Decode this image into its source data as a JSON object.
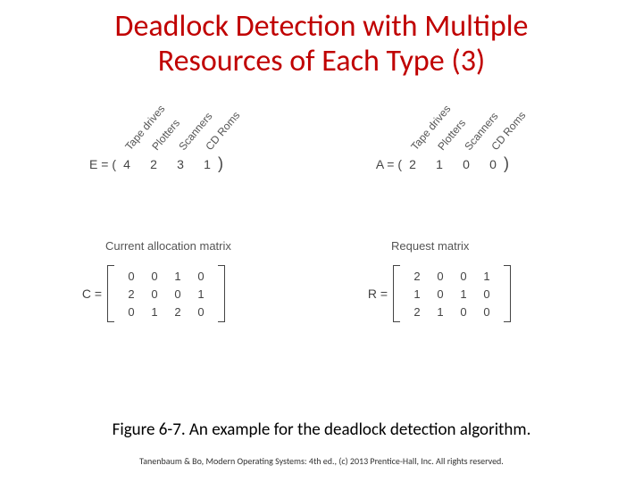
{
  "title_line1": "Deadlock Detection with Multiple",
  "title_line2": "Resources of Each Type (3)",
  "resources": [
    "Tape drives",
    "Plotters",
    "Scanners",
    "CD Roms"
  ],
  "E": {
    "name": "E = (",
    "vals": [
      "4",
      "2",
      "3",
      "1"
    ],
    "close": ")"
  },
  "A": {
    "name": "A = (",
    "vals": [
      "2",
      "1",
      "0",
      "0"
    ],
    "close": ")"
  },
  "C": {
    "title": "Current allocation matrix",
    "name": "C =",
    "rows": [
      [
        "0",
        "0",
        "1",
        "0"
      ],
      [
        "2",
        "0",
        "0",
        "1"
      ],
      [
        "0",
        "1",
        "2",
        "0"
      ]
    ]
  },
  "R": {
    "title": "Request matrix",
    "name": "R =",
    "rows": [
      [
        "2",
        "0",
        "0",
        "1"
      ],
      [
        "1",
        "0",
        "1",
        "0"
      ],
      [
        "2",
        "1",
        "0",
        "0"
      ]
    ]
  },
  "caption": "Figure 6-7. An example for the deadlock detection algorithm.",
  "footer": "Tanenbaum & Bo, Modern Operating Systems: 4th ed., (c) 2013 Prentice-Hall, Inc. All rights reserved."
}
